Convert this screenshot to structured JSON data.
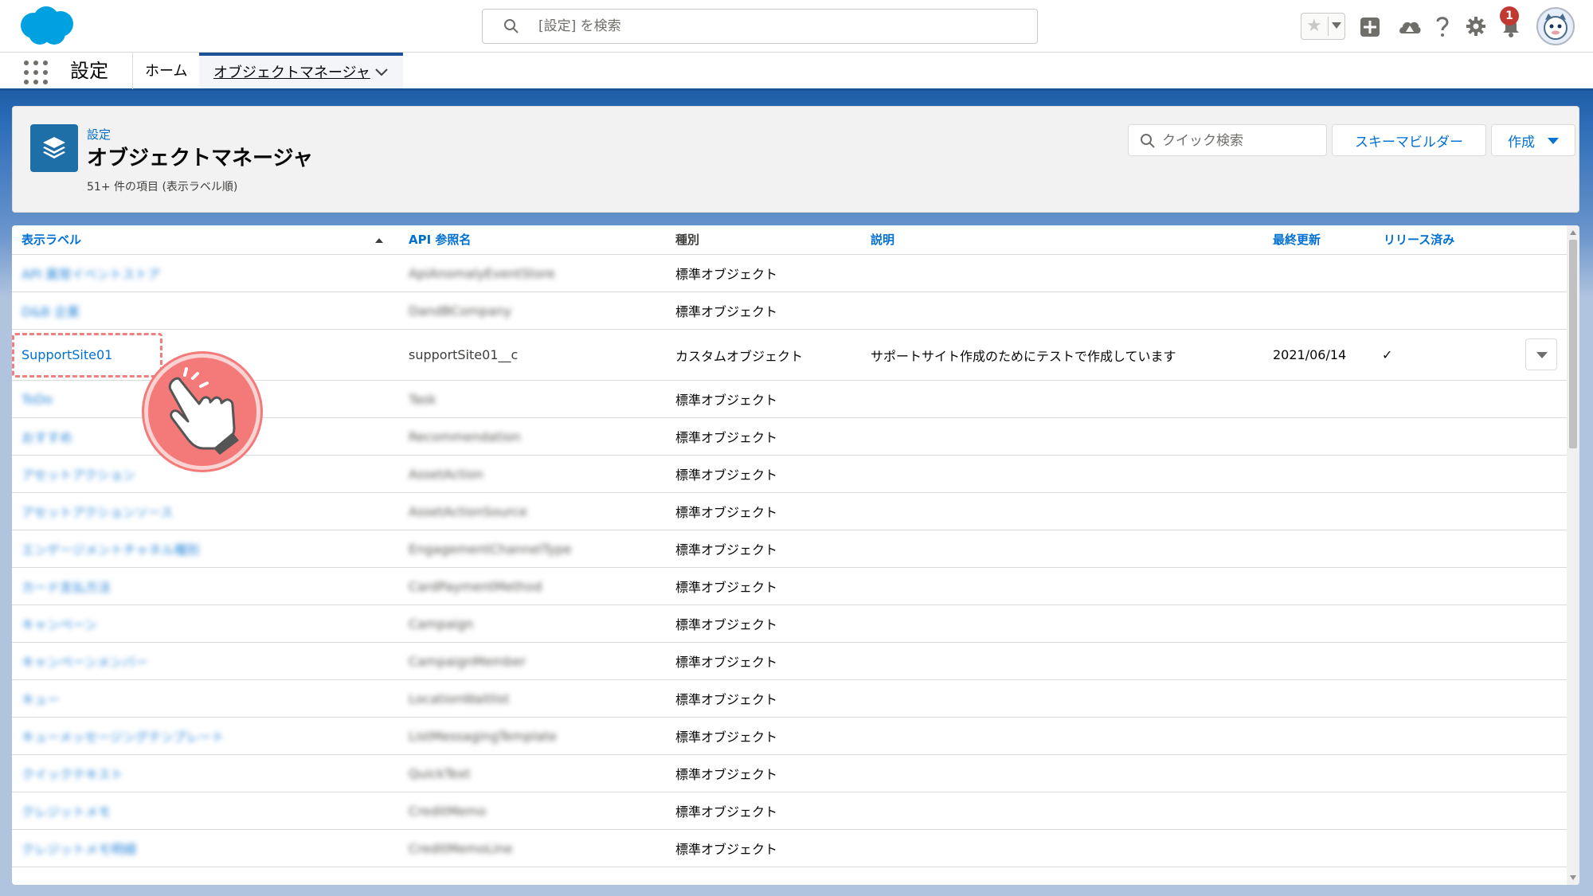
{
  "header": {
    "search_placeholder": "[設定] を検索",
    "notification_count": "1"
  },
  "nav": {
    "app_name": "設定",
    "home": "ホーム",
    "active_tab": "オブジェクトマネージャ"
  },
  "page": {
    "breadcrumb": "設定",
    "title": "オブジェクトマネージャ",
    "meta": "51+ 件の項目 (表示ラベル順)",
    "quick_search_placeholder": "クイック検索",
    "schema_builder": "スキーマビルダー",
    "create": "作成"
  },
  "table": {
    "columns": {
      "label": "表示ラベル",
      "api": "API 参照名",
      "type": "種別",
      "description": "説明",
      "modified": "最終更新",
      "deployed": "リリース済み"
    },
    "rows": [
      {
        "label": "API 異常イベントストア",
        "api": "ApiAnomalyEventStore",
        "type": "標準オブジェクト",
        "description": "",
        "modified": "",
        "deployed": ""
      },
      {
        "label": "D&B 企業",
        "api": "DandBCompany",
        "type": "標準オブジェクト",
        "description": "",
        "modified": "",
        "deployed": ""
      },
      {
        "label": "SupportSite01",
        "api": "supportSite01__c",
        "type": "カスタムオブジェクト",
        "description": "サポートサイト作成のためにテストで作成しています",
        "modified": "2021/06/14",
        "deployed": "✓"
      },
      {
        "label": "ToDo",
        "api": "Task",
        "type": "標準オブジェクト",
        "description": "",
        "modified": "",
        "deployed": ""
      },
      {
        "label": "おすすめ",
        "api": "Recommendation",
        "type": "標準オブジェクト",
        "description": "",
        "modified": "",
        "deployed": ""
      },
      {
        "label": "アセットアクション",
        "api": "AssetAction",
        "type": "標準オブジェクト",
        "description": "",
        "modified": "",
        "deployed": ""
      },
      {
        "label": "アセットアクションソース",
        "api": "AssetActionSource",
        "type": "標準オブジェクト",
        "description": "",
        "modified": "",
        "deployed": ""
      },
      {
        "label": "エンゲージメントチャネル種別",
        "api": "EngagementChannelType",
        "type": "標準オブジェクト",
        "description": "",
        "modified": "",
        "deployed": ""
      },
      {
        "label": "カード支払方法",
        "api": "CardPaymentMethod",
        "type": "標準オブジェクト",
        "description": "",
        "modified": "",
        "deployed": ""
      },
      {
        "label": "キャンペーン",
        "api": "Campaign",
        "type": "標準オブジェクト",
        "description": "",
        "modified": "",
        "deployed": ""
      },
      {
        "label": "キャンペーンメンバー",
        "api": "CampaignMember",
        "type": "標準オブジェクト",
        "description": "",
        "modified": "",
        "deployed": ""
      },
      {
        "label": "キュー",
        "api": "LocationWaitlist",
        "type": "標準オブジェクト",
        "description": "",
        "modified": "",
        "deployed": ""
      },
      {
        "label": "キューメッセージングテンプレート",
        "api": "ListMessagingTemplate",
        "type": "標準オブジェクト",
        "description": "",
        "modified": "",
        "deployed": ""
      },
      {
        "label": "クイックテキスト",
        "api": "QuickText",
        "type": "標準オブジェクト",
        "description": "",
        "modified": "",
        "deployed": ""
      },
      {
        "label": "クレジットメモ",
        "api": "CreditMemo",
        "type": "標準オブジェクト",
        "description": "",
        "modified": "",
        "deployed": ""
      },
      {
        "label": "クレジットメモ明細",
        "api": "CreditMemoLine",
        "type": "標準オブジェクト",
        "description": "",
        "modified": "",
        "deployed": ""
      }
    ]
  },
  "colors": {
    "brand": "#0070d2",
    "nav_accent": "#1b5297",
    "annotation": "#f47a7a"
  },
  "icons": [
    "salesforce-cloud-icon",
    "search-icon",
    "star-icon",
    "add-icon",
    "trailhead-icon",
    "help-icon",
    "gear-icon",
    "bell-icon",
    "waffle-icon",
    "chevron-down-icon",
    "layers-icon",
    "checkmark-icon",
    "pointer-hand-icon"
  ]
}
